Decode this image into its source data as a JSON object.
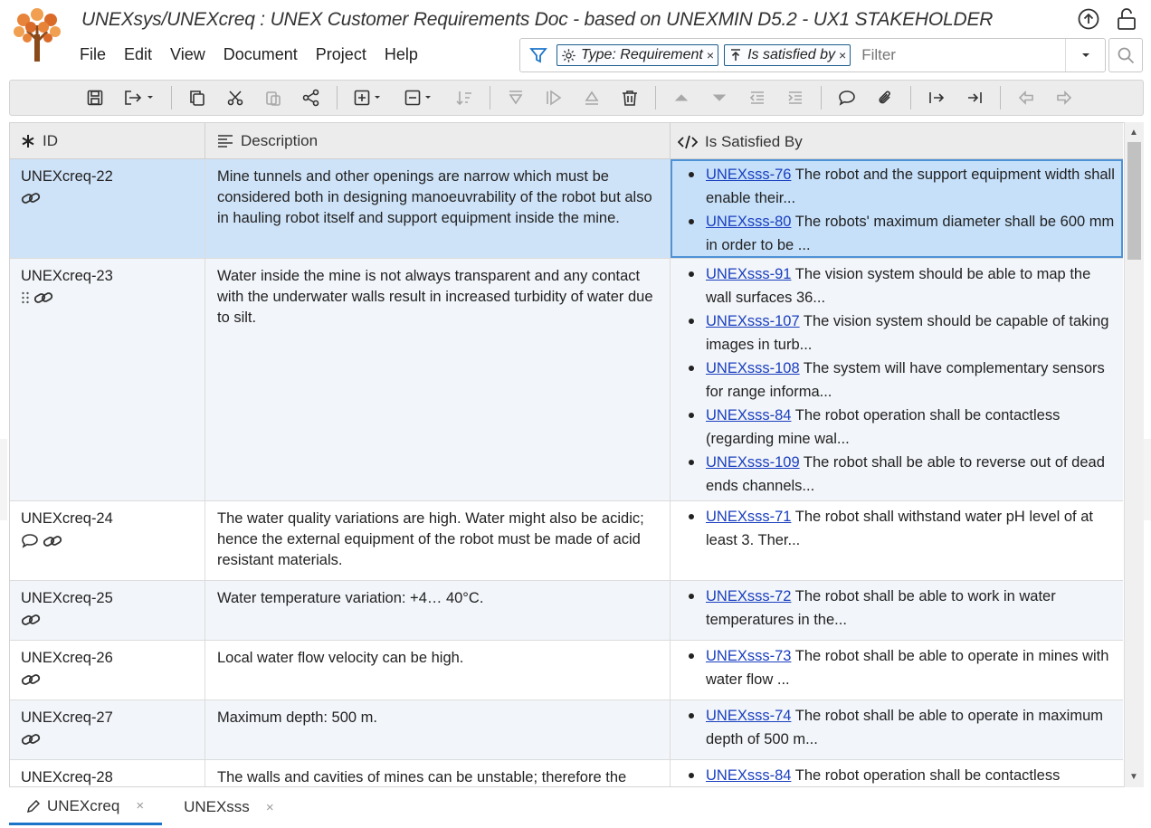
{
  "header": {
    "title": "UNEXsys/UNEXcreq : UNEX Customer Requirements Doc - based on UNEXMIN D5.2 - UX1 STAKEHOLDER"
  },
  "menu": [
    "File",
    "Edit",
    "View",
    "Document",
    "Project",
    "Help"
  ],
  "filter": {
    "chips": [
      "Type: Requirement",
      "Is satisfied by"
    ],
    "chip_close": "×",
    "placeholder": "Filter"
  },
  "table": {
    "columns": [
      "ID",
      "Description",
      "Is Satisfied By"
    ],
    "rows": [
      {
        "id": "UNEXcreq-22",
        "description": "Mine tunnels and other openings are narrow which must be considered both in designing manoeuvrability of the robot but also in hauling robot itself and support equipment inside the mine.",
        "satisfied_by": [
          {
            "link": "UNEXsss-76",
            "text": " The robot and the support equipment width shall enable their..."
          },
          {
            "link": "UNEXsss-80",
            "text": " The robots' maximum diameter shall be 600 mm in order to be ..."
          }
        ]
      },
      {
        "id": "UNEXcreq-23",
        "description": "Water inside the mine is not always transparent and any contact with the underwater walls result in increased turbidity of water due to silt.",
        "satisfied_by": [
          {
            "link": "UNEXsss-91",
            "text": " The vision system should be able to map the wall surfaces 36..."
          },
          {
            "link": "UNEXsss-107",
            "text": " The vision system should be capable of taking images in turb..."
          },
          {
            "link": "UNEXsss-108",
            "text": " The system will have complementary sensors for range informa..."
          },
          {
            "link": "UNEXsss-84",
            "text": " The robot operation shall be contactless (regarding mine wal..."
          },
          {
            "link": "UNEXsss-109",
            "text": " The robot shall be able to reverse out of dead ends channels..."
          }
        ]
      },
      {
        "id": "UNEXcreq-24",
        "description": "The water quality variations are high. Water might also be acidic; hence the external equipment of the robot must be made of acid resistant materials.",
        "satisfied_by": [
          {
            "link": "UNEXsss-71",
            "text": " The robot shall withstand water pH level of at least 3. Ther..."
          }
        ]
      },
      {
        "id": "UNEXcreq-25",
        "description": "Water temperature variation: +4… 40°C.",
        "satisfied_by": [
          {
            "link": "UNEXsss-72",
            "text": " The robot shall be able to work in water temperatures in the..."
          }
        ]
      },
      {
        "id": "UNEXcreq-26",
        "description": "Local water flow velocity can be high.",
        "satisfied_by": [
          {
            "link": "UNEXsss-73",
            "text": " The robot shall be able to operate in mines with water flow ..."
          }
        ]
      },
      {
        "id": "UNEXcreq-27",
        "description": "Maximum depth: 500 m.",
        "satisfied_by": [
          {
            "link": "UNEXsss-74",
            "text": " The robot shall be able to operate in maximum depth of 500 m..."
          }
        ]
      },
      {
        "id": "UNEXcreq-28",
        "description": "The walls and cavities of mines can be unstable; therefore the",
        "satisfied_by": [
          {
            "link": "UNEXsss-84",
            "text": " The robot operation shall be contactless"
          }
        ]
      }
    ]
  },
  "tabs": [
    "UNEXcreq",
    "UNEXsss"
  ],
  "tab_close": "×",
  "colors": {
    "selected_row": "#cfe3f8",
    "link": "#1a3fbf",
    "active_tab": "#1c74c9"
  }
}
